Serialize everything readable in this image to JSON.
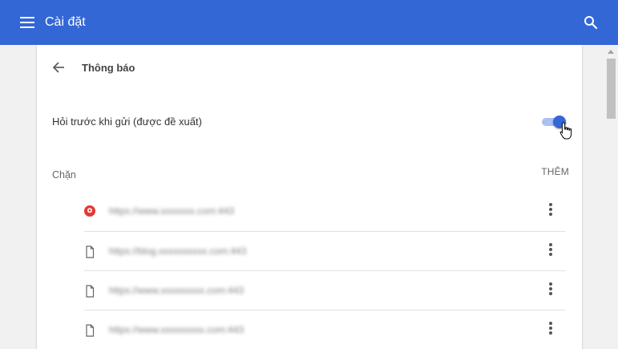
{
  "header": {
    "title": "Cài đặt",
    "menu_icon": "menu-icon",
    "search_icon": "search-icon",
    "background_color": "#3367d6"
  },
  "panel": {
    "back_icon": "arrow-back-icon",
    "title": "Thông báo"
  },
  "ask_before_sending": {
    "label": "Hỏi trước khi gửi (được đề xuất)",
    "enabled": true,
    "accent_color": "#3367d6"
  },
  "blocked": {
    "label": "Chặn",
    "add_label": "THÊM",
    "sites": [
      {
        "icon": "site-favicon-icon",
        "url": "https://www.xxxxxxx.com:443"
      },
      {
        "icon": "file-icon",
        "url": "https://blog.xxxxxxxxxx.com:443"
      },
      {
        "icon": "file-icon",
        "url": "https://www.xxxxxxxxx.com:443"
      },
      {
        "icon": "file-icon",
        "url": "https://www.xxxxxxxxx.com:443"
      }
    ],
    "more_icon": "more-vert-icon"
  }
}
